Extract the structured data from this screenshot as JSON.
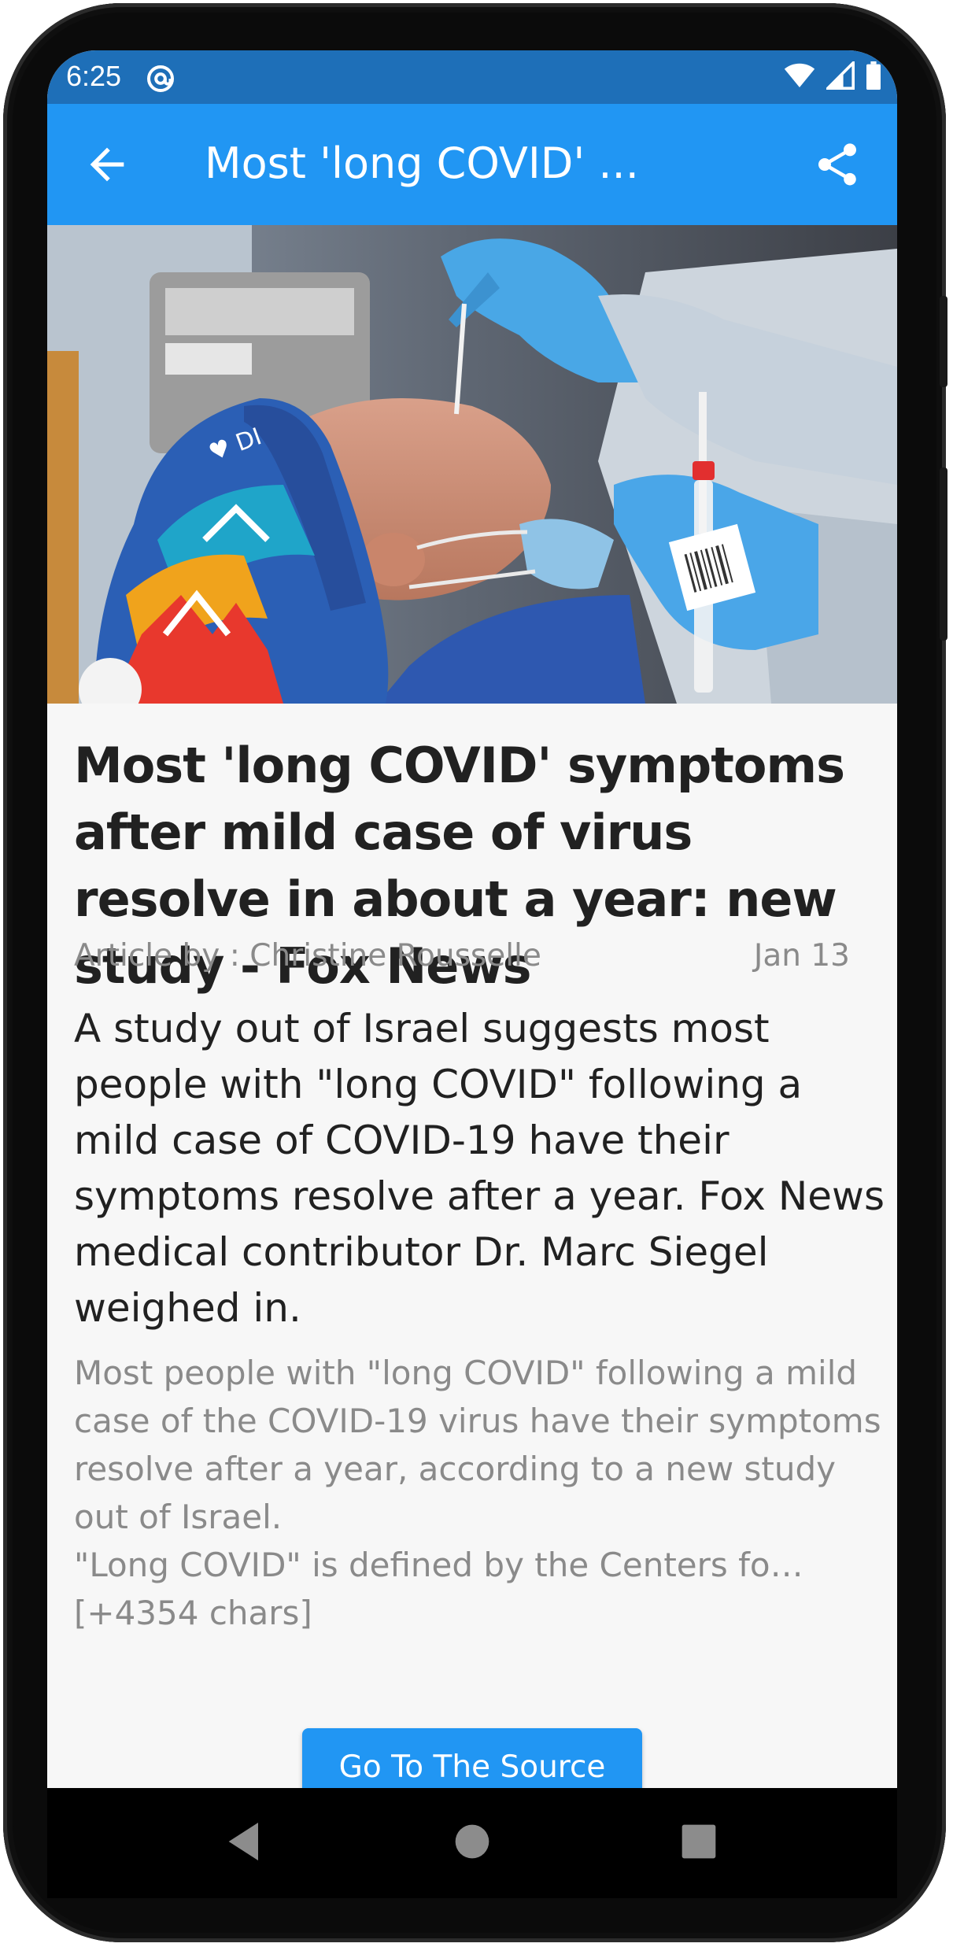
{
  "status_bar": {
    "time": "6:25",
    "bg_color": "#1e6fb8",
    "icons": [
      "at-sign-icon",
      "wifi-icon",
      "signal-icon",
      "battery-icon"
    ]
  },
  "app_bar": {
    "title": "Most 'long COVID' ...",
    "back_icon": "arrow-back-icon",
    "share_icon": "share-icon",
    "color": "#2196f3"
  },
  "hero_image": {
    "description_icon": "news-photo"
  },
  "article": {
    "headline": "Most 'long COVID' symptoms after mild case of virus resolve in about a year: new study - Fox News",
    "byline": "Article by : Christine Rousselle",
    "date": "Jan 13",
    "description": "A study out of Israel suggests most people with \"long COVID\" following a mild case of COVID-19 have their symptoms resolve after a year. Fox News medical contributor Dr. Marc Siegel weighed in.",
    "content": "Most people with \"long COVID\" following a mild case of the COVID-19 virus have their symptoms resolve after a year, according to a new study out of Israel.\n\"Long COVID\" is defined by the Centers fo… [+4354 chars]"
  },
  "buttons": {
    "source_label": "Go To The Source"
  },
  "nav_bar": {
    "icons": [
      "back-triangle-icon",
      "home-circle-icon",
      "recents-square-icon"
    ]
  }
}
